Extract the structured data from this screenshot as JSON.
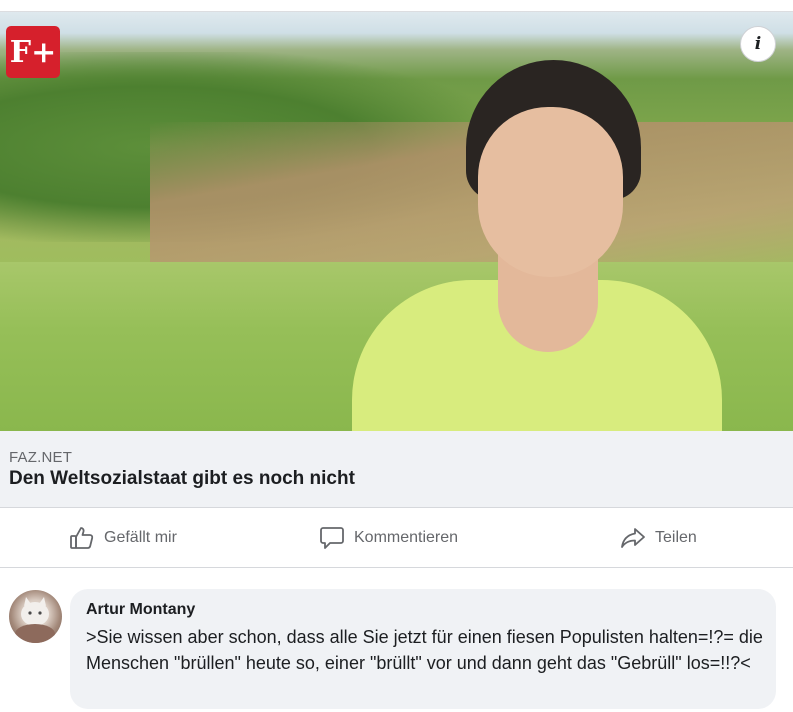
{
  "post": {
    "badge_text": "F+",
    "info_label": "i",
    "link": {
      "domain": "FAZ.NET",
      "title": "Den Weltsozialstaat gibt es noch nicht"
    }
  },
  "actions": {
    "like_label": "Gefällt mir",
    "comment_label": "Kommentieren",
    "share_label": "Teilen"
  },
  "comment": {
    "author": "Artur Montany",
    "text": ">Sie wissen aber schon, dass alle Sie jetzt für einen fiesen Populisten halten=!?= die Menschen \"brüllen\" heute so, einer \"brüllt\" vor und dann geht das \"Gebrüll\" los=!!?<"
  },
  "colors": {
    "badge_red": "#d6202c",
    "secondary_text": "#65676b",
    "primary_text": "#1c1e21",
    "surface_gray": "#f0f2f5"
  },
  "icons": {
    "like": "thumbs-up-icon",
    "comment": "speech-bubble-icon",
    "share": "share-arrow-icon",
    "info": "info-icon"
  }
}
